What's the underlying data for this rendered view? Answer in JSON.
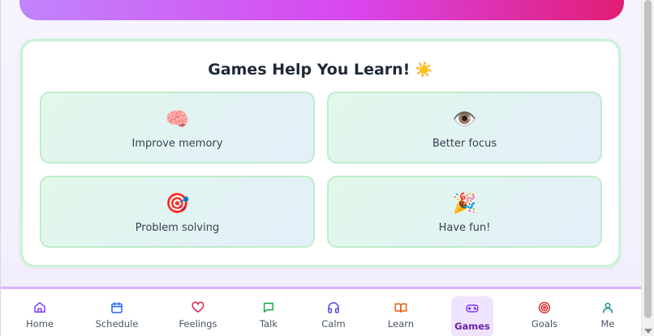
{
  "banner": {
    "colors": [
      "#c084fc",
      "#d946ef",
      "#e11d74"
    ]
  },
  "benefits": {
    "title": "Games Help You Learn!",
    "title_icon": "☀️",
    "items": [
      {
        "icon": "🧠",
        "icon_name": "brain-icon",
        "label": "Improve memory"
      },
      {
        "icon": "👁️",
        "icon_name": "eye-icon",
        "label": "Better focus"
      },
      {
        "icon": "🎯",
        "icon_name": "target-icon",
        "label": "Problem solving"
      },
      {
        "icon": "🎉",
        "icon_name": "party-popper-icon",
        "label": "Have fun!"
      }
    ]
  },
  "nav": {
    "items": [
      {
        "label": "Home",
        "icon": "home-icon",
        "color": "#7c3aed"
      },
      {
        "label": "Schedule",
        "icon": "calendar-icon",
        "color": "#2563eb"
      },
      {
        "label": "Feelings",
        "icon": "heart-icon",
        "color": "#e11d48"
      },
      {
        "label": "Talk",
        "icon": "chat-icon",
        "color": "#16a34a"
      },
      {
        "label": "Calm",
        "icon": "headphones-icon",
        "color": "#4f46e5"
      },
      {
        "label": "Learn",
        "icon": "book-icon",
        "color": "#ea580c"
      },
      {
        "label": "Games",
        "icon": "gamepad-icon",
        "color": "#7c3aed",
        "active": true
      },
      {
        "label": "Goals",
        "icon": "target-icon",
        "color": "#dc2626"
      },
      {
        "label": "Me",
        "icon": "user-icon",
        "color": "#0d9488"
      }
    ]
  }
}
